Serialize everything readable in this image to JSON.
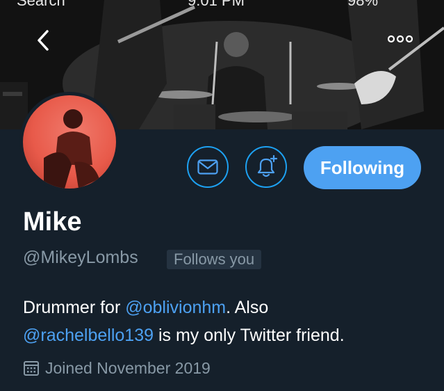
{
  "status_bar": {
    "carrier": "Search",
    "time": "9:01 PM",
    "battery": "98%"
  },
  "header": {
    "back_icon": "chevron-left-icon",
    "more_icon": "more-horizontal-icon"
  },
  "profile": {
    "display_name": "Mike",
    "handle": "@MikeyLombs",
    "follows_you": "Follows you",
    "bio": {
      "part1": "Drummer for ",
      "mention1": "@oblivionhm",
      "part2": ". Also ",
      "mention2": "@rachelbello139",
      "part3": " is my only Twitter friend."
    },
    "joined": "Joined November 2019"
  },
  "actions": {
    "message_icon": "envelope-icon",
    "notify_icon": "bell-plus-icon",
    "follow_label": "Following"
  },
  "colors": {
    "background": "#15202b",
    "accent": "#4da1f2",
    "muted": "#8899a6"
  }
}
